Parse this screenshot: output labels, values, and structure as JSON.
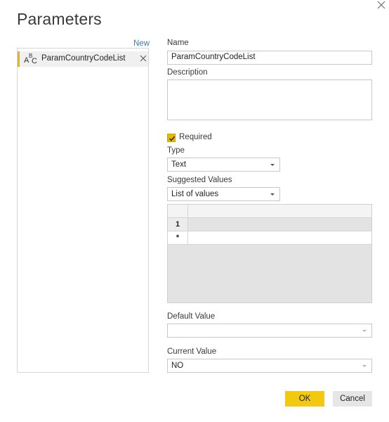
{
  "dialog": {
    "title": "Parameters"
  },
  "list": {
    "new_label": "New",
    "items": [
      {
        "label": "ParamCountryCodeList",
        "type_icon": "abc-text-type-icon"
      }
    ]
  },
  "form": {
    "name_label": "Name",
    "name_value": "ParamCountryCodeList",
    "description_label": "Description",
    "description_value": "",
    "required_label": "Required",
    "required_checked": true,
    "type_label": "Type",
    "type_value": "Text",
    "suggested_label": "Suggested Values",
    "suggested_value": "List of values",
    "grid_rows": [
      {
        "header": "1",
        "value": ""
      },
      {
        "header": "*",
        "value": ""
      }
    ],
    "default_label": "Default Value",
    "default_value": "",
    "current_label": "Current Value",
    "current_value": "NO"
  },
  "buttons": {
    "ok": "OK",
    "cancel": "Cancel"
  },
  "colors": {
    "accent": "#f2c811",
    "link": "#2f7bc9"
  }
}
